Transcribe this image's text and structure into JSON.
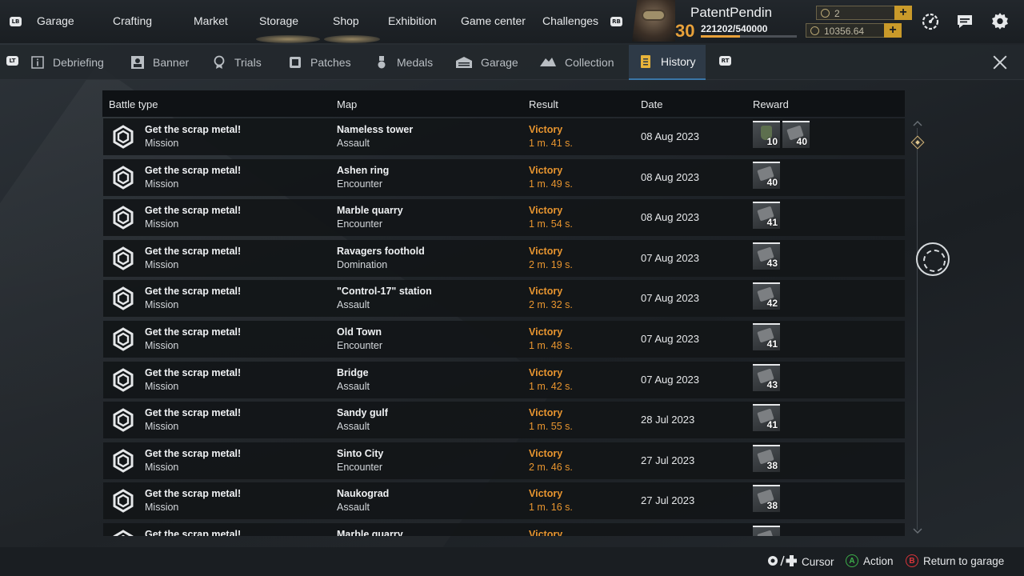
{
  "top_nav": {
    "lb": "LB",
    "rb": "RB",
    "items": [
      "Garage",
      "Crafting",
      "Market",
      "Storage",
      "Shop",
      "Exhibition",
      "Game center",
      "Challenges"
    ]
  },
  "player": {
    "name": "PatentPendin",
    "level": "30",
    "xp": "221202/540000",
    "xp_fraction": 0.41,
    "currency1": "2",
    "currency2": "10356.64",
    "accent": "#e8a13a"
  },
  "sub_nav": {
    "lt": "LT",
    "rt": "RT",
    "tabs": [
      "Debriefing",
      "Banner",
      "Trials",
      "Patches",
      "Medals",
      "Garage",
      "Collection",
      "History"
    ],
    "active": "History"
  },
  "table": {
    "headers": [
      "Battle type",
      "Map",
      "Result",
      "Date",
      "Reward"
    ],
    "rows": [
      {
        "type": "Get the scrap metal!",
        "mode": "Mission",
        "map": "Nameless tower",
        "map_mode": "Assault",
        "result": "Victory",
        "time": "1 m. 41 s.",
        "date": "08 Aug 2023",
        "rewards": [
          "10",
          "40"
        ]
      },
      {
        "type": "Get the scrap metal!",
        "mode": "Mission",
        "map": "Ashen ring",
        "map_mode": "Encounter",
        "result": "Victory",
        "time": "1 m. 49 s.",
        "date": "08 Aug 2023",
        "rewards": [
          "40"
        ]
      },
      {
        "type": "Get the scrap metal!",
        "mode": "Mission",
        "map": "Marble quarry",
        "map_mode": "Encounter",
        "result": "Victory",
        "time": "1 m. 54 s.",
        "date": "08 Aug 2023",
        "rewards": [
          "41"
        ]
      },
      {
        "type": "Get the scrap metal!",
        "mode": "Mission",
        "map": "Ravagers foothold",
        "map_mode": "Domination",
        "result": "Victory",
        "time": "2 m. 19 s.",
        "date": "07 Aug 2023",
        "rewards": [
          "43"
        ]
      },
      {
        "type": "Get the scrap metal!",
        "mode": "Mission",
        "map": "\"Control-17\" station",
        "map_mode": "Assault",
        "result": "Victory",
        "time": "2 m. 32 s.",
        "date": "07 Aug 2023",
        "rewards": [
          "42"
        ]
      },
      {
        "type": "Get the scrap metal!",
        "mode": "Mission",
        "map": "Old Town",
        "map_mode": "Encounter",
        "result": "Victory",
        "time": "1 m. 48 s.",
        "date": "07 Aug 2023",
        "rewards": [
          "41"
        ]
      },
      {
        "type": "Get the scrap metal!",
        "mode": "Mission",
        "map": "Bridge",
        "map_mode": "Assault",
        "result": "Victory",
        "time": "1 m. 42 s.",
        "date": "07 Aug 2023",
        "rewards": [
          "43"
        ]
      },
      {
        "type": "Get the scrap metal!",
        "mode": "Mission",
        "map": "Sandy gulf",
        "map_mode": "Assault",
        "result": "Victory",
        "time": "1 m. 55 s.",
        "date": "28 Jul 2023",
        "rewards": [
          "41"
        ]
      },
      {
        "type": "Get the scrap metal!",
        "mode": "Mission",
        "map": "Sinto City",
        "map_mode": "Encounter",
        "result": "Victory",
        "time": "2 m. 46 s.",
        "date": "27 Jul 2023",
        "rewards": [
          "38"
        ]
      },
      {
        "type": "Get the scrap metal!",
        "mode": "Mission",
        "map": "Naukograd",
        "map_mode": "Assault",
        "result": "Victory",
        "time": "1 m. 16 s.",
        "date": "27 Jul 2023",
        "rewards": [
          "38"
        ]
      },
      {
        "type": "Get the scrap metal!",
        "mode": "Mission",
        "map": "Marble quarry",
        "map_mode": "",
        "result": "Victory",
        "time": "",
        "date": "",
        "rewards": [
          ""
        ]
      }
    ]
  },
  "footer": {
    "cursor": "Cursor",
    "action": "Action",
    "return": "Return to garage"
  },
  "colors": {
    "victory": "#e8952f",
    "active_tab": "#2e3a47"
  }
}
